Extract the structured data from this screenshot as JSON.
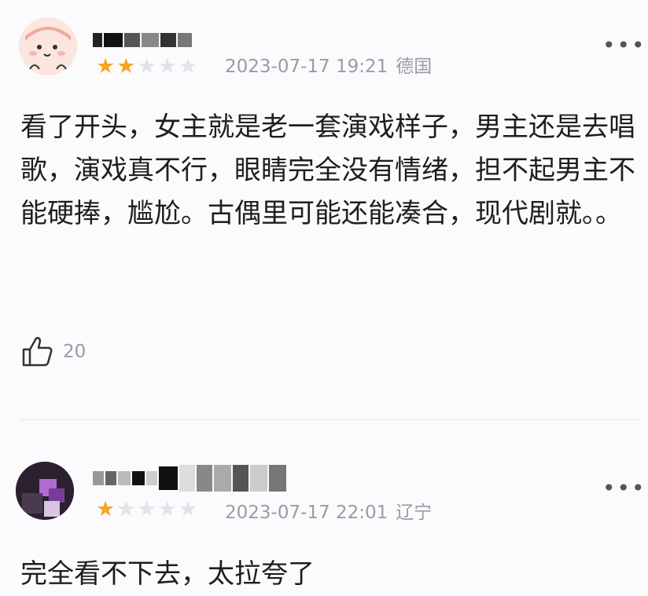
{
  "comments": [
    {
      "stars_on": "★★",
      "stars_off": "★★★",
      "date": "2023-07-17 19:21",
      "location": "德国",
      "more": "•••",
      "text": "看了开头，女主就是老一套演戏样子，男主还是去唱歌，演戏真不行，眼睛完全没有情绪，担不起男主不能硬捧，尴尬。古偶里可能还能凑合，现代剧就。。",
      "likes": "20"
    },
    {
      "stars_on": "★",
      "stars_off": "★★★★",
      "date": "2023-07-17 22:01",
      "location": "辽宁",
      "more": "•••",
      "text": "完全看不下去，太拉夸了"
    }
  ],
  "colors": {
    "star_on": "#f5a623",
    "star_off": "#e1e3e8",
    "meta_text": "#9a9ca3",
    "body_text": "#1e1e1e",
    "background": "#fbfbfd"
  },
  "icons": [
    "avatar",
    "star-icon",
    "more-icon",
    "thumbs-up-icon"
  ]
}
